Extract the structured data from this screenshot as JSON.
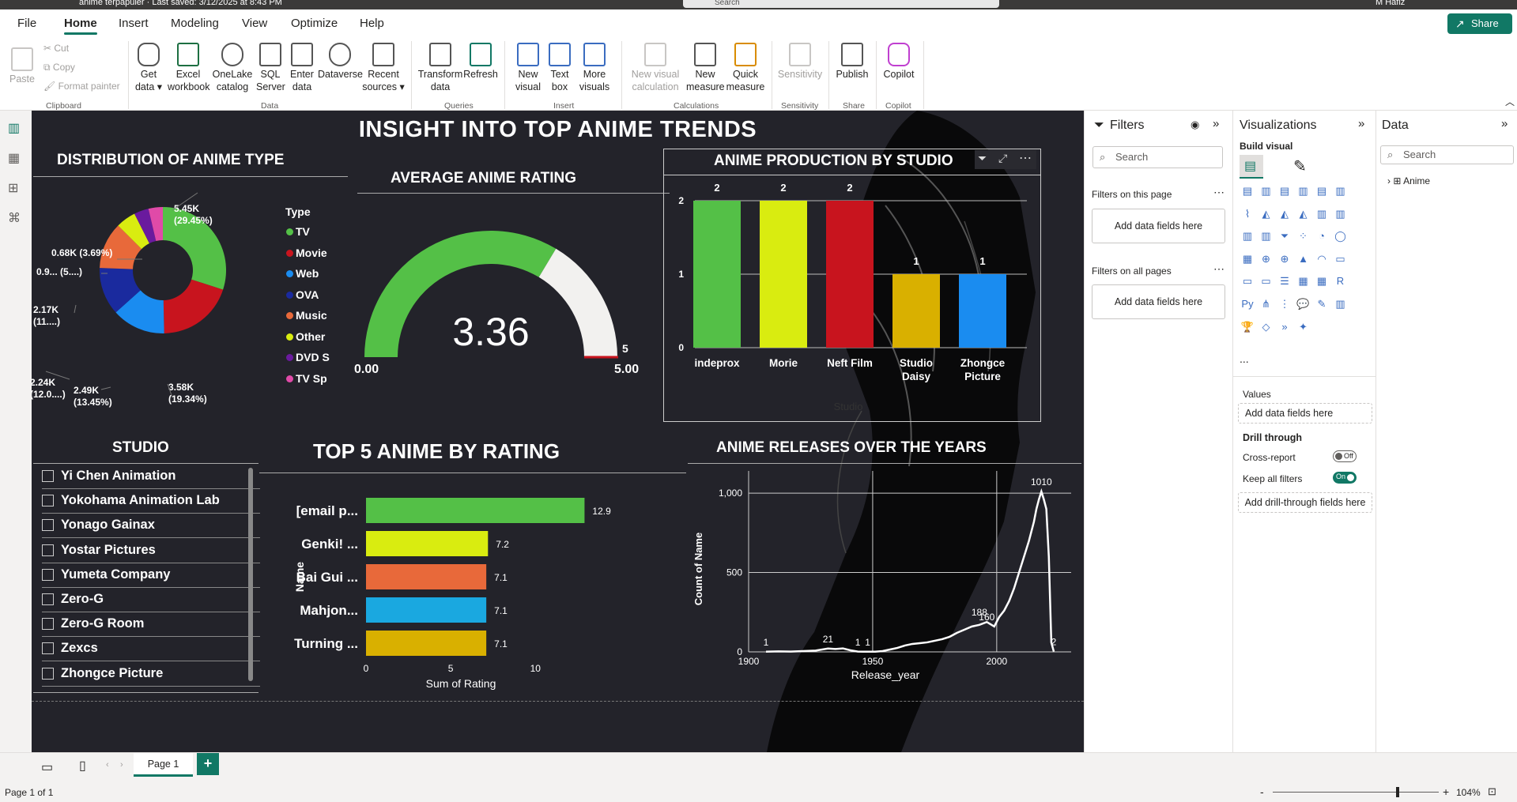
{
  "titlebar": {
    "text": "anime terpapuler  ·  Last saved: 3/12/2025 at 8:43 PM",
    "search_placeholder": "Search",
    "user": "M Hafiz"
  },
  "menu": {
    "items": [
      "File",
      "Home",
      "Insert",
      "Modeling",
      "View",
      "Optimize",
      "Help"
    ],
    "share": "Share"
  },
  "ribbon": {
    "clipboard": {
      "paste": "Paste",
      "cut": "Cut",
      "copy": "Copy",
      "format_painter": "Format painter",
      "group": "Clipboard"
    },
    "data": {
      "get_data": "Get data",
      "excel": "Excel workbook",
      "onelake": "OneLake catalog",
      "sql": "SQL Server",
      "enter": "Enter data",
      "dataverse": "Dataverse",
      "recent": "Recent sources",
      "group": "Data"
    },
    "queries": {
      "transform": "Transform data",
      "refresh": "Refresh",
      "group": "Queries"
    },
    "insert": {
      "new_visual": "New visual",
      "text_box": "Text box",
      "more": "More visuals",
      "group": "Insert"
    },
    "calculations": {
      "new_calc": "New visual calculation",
      "new_measure": "New measure",
      "quick_measure": "Quick measure",
      "group": "Calculations"
    },
    "sensitivity": {
      "label": "Sensitivity",
      "group": "Sensitivity"
    },
    "share": {
      "publish": "Publish",
      "group": "Share"
    },
    "copilot": {
      "label": "Copilot",
      "group": "Copilot"
    }
  },
  "dashboard": {
    "title": "INSIGHT INTO TOP ANIME TRENDS",
    "donut": {
      "title": "DISTRIBUTION OF ANIME TYPE",
      "legend_title": "Type",
      "legend": [
        {
          "name": "TV",
          "color": "#54c047"
        },
        {
          "name": "Movie",
          "color": "#c8141e"
        },
        {
          "name": "Web",
          "color": "#1a8cf0"
        },
        {
          "name": "OVA",
          "color": "#1a2a9e"
        },
        {
          "name": "Music",
          "color": "#e8693a"
        },
        {
          "name": "Other",
          "color": "#d9ec10"
        },
        {
          "name": "DVD S",
          "color": "#6a1a9e"
        },
        {
          "name": "TV Sp",
          "color": "#e04aa8"
        }
      ],
      "labels": {
        "tv": [
          "5.45K",
          "(29.45%)"
        ],
        "movie": [
          "3.58K",
          "(19.34%)"
        ],
        "web": [
          "2.49K",
          "(13.45%)"
        ],
        "ova": [
          "2.24K",
          "(12.0....)"
        ],
        "music": [
          "2.17K",
          "(11....)"
        ],
        "other": [
          "0.9... (5....)"
        ],
        "dvd": [
          "0.68K (3.69%)"
        ]
      }
    },
    "gauge": {
      "title": "AVERAGE ANIME RATING",
      "value": "3.36",
      "min": "0.00",
      "max": "5.00",
      "target": "5",
      "fraction": 0.672
    },
    "studio_bar": {
      "title": "ANIME PRODUCTION BY STUDIO",
      "axis_label": "Studio"
    },
    "slicer": {
      "title": "STUDIO",
      "items": [
        "Yi Chen Animation",
        "Yokohama Animation Lab",
        "Yonago Gainax",
        "Yostar Pictures",
        "Yumeta Company",
        "Zero-G",
        "Zero-G Room",
        "Zexcs",
        "Zhongce Picture"
      ]
    },
    "top5": {
      "title": "TOP 5 ANIME BY RATING",
      "ylabel": "Name",
      "xlabel": "Sum of Rating"
    },
    "releases": {
      "title": "ANIME RELEASES OVER THE YEARS",
      "ylabel": "Count of Name",
      "xlabel": "Release_year"
    }
  },
  "chart_data": [
    {
      "type": "pie",
      "title": "DISTRIBUTION OF ANIME TYPE",
      "categories": [
        "TV",
        "Movie",
        "Web",
        "OVA",
        "Music",
        "Other",
        "DVD S",
        "TV Sp"
      ],
      "values": [
        29.45,
        19.34,
        13.45,
        12.0,
        11.7,
        5.0,
        3.69,
        3.6
      ],
      "colors": [
        "#54c047",
        "#c8141e",
        "#1a8cf0",
        "#1a2a9e",
        "#e8693a",
        "#d9ec10",
        "#6a1a9e",
        "#e04aa8"
      ]
    },
    {
      "type": "bar",
      "title": "ANIME PRODUCTION BY STUDIO",
      "xlabel": "Studio",
      "categories": [
        "indeprox",
        "Morie",
        "Neft Film",
        "Studio Daisy",
        "Zhongce Picture"
      ],
      "values": [
        2,
        2,
        2,
        1,
        1
      ],
      "colors": [
        "#54c047",
        "#d9ec10",
        "#c8141e",
        "#d9b000",
        "#1a8cf0"
      ],
      "ylim": [
        0,
        2
      ],
      "yticks": [
        0,
        1,
        2
      ]
    },
    {
      "type": "bar",
      "title": "TOP 5 ANIME BY RATING",
      "orientation": "horizontal",
      "xlabel": "Sum of Rating",
      "ylabel": "Name",
      "categories": [
        "[email p...",
        "Genki! ...",
        "Bai Gui ...",
        "Mahjon...",
        "Turning ..."
      ],
      "values": [
        12.9,
        7.2,
        7.1,
        7.1,
        7.1
      ],
      "colors": [
        "#54c047",
        "#d9ec10",
        "#e8693a",
        "#1aa8e0",
        "#d9b000"
      ],
      "xlim": [
        0,
        14
      ],
      "xticks": [
        0,
        5,
        10
      ]
    },
    {
      "type": "line",
      "title": "ANIME RELEASES OVER THE YEARS",
      "xlabel": "Release_year",
      "ylabel": "Count of Name",
      "xlim": [
        1900,
        2030
      ],
      "ylim": [
        0,
        1100
      ],
      "xticks": [
        1900,
        1950,
        2000
      ],
      "yticks": [
        0,
        500,
        1000
      ],
      "ytick_labels": [
        "0",
        "500",
        "1,000"
      ],
      "x": [
        1907,
        1912,
        1917,
        1922,
        1927,
        1932,
        1935,
        1938,
        1941,
        1944,
        1946,
        1948,
        1951,
        1954,
        1957,
        1960,
        1963,
        1966,
        1969,
        1972,
        1975,
        1978,
        1981,
        1984,
        1987,
        1990,
        1993,
        1996,
        1999,
        2001,
        2003,
        2005,
        2007,
        2009,
        2011,
        2013,
        2015,
        2016,
        2017,
        2018,
        2019,
        2020,
        2021,
        2022,
        2023
      ],
      "y": [
        1,
        3,
        2,
        5,
        8,
        21,
        18,
        22,
        10,
        2,
        1,
        1,
        1,
        5,
        15,
        25,
        40,
        50,
        55,
        60,
        70,
        80,
        95,
        120,
        140,
        160,
        170,
        188,
        160,
        220,
        260,
        320,
        400,
        500,
        600,
        700,
        820,
        900,
        960,
        1010,
        960,
        900,
        600,
        60,
        2
      ],
      "point_labels": [
        {
          "x": 1907,
          "y": 1,
          "text": "1"
        },
        {
          "x": 1932,
          "y": 21,
          "text": "21"
        },
        {
          "x": 1944,
          "y": 1,
          "text": "1"
        },
        {
          "x": 1948,
          "y": 1,
          "text": "1"
        },
        {
          "x": 1993,
          "y": 188,
          "text": "188"
        },
        {
          "x": 1996,
          "y": 160,
          "text": "160"
        },
        {
          "x": 2018,
          "y": 1010,
          "text": "1010"
        },
        {
          "x": 2023,
          "y": 2,
          "text": "2"
        }
      ]
    }
  ],
  "filters": {
    "title": "Filters",
    "search": "Search",
    "this_page": "Filters on this page",
    "all_pages": "Filters on all pages",
    "add": "Add data fields here"
  },
  "viz": {
    "title": "Visualizations",
    "build": "Build visual",
    "values": "Values",
    "add": "Add data fields here",
    "drill": "Drill through",
    "cross": "Cross-report",
    "cross_state": "Off",
    "keep": "Keep all filters",
    "keep_state": "On",
    "add_drill": "Add drill-through fields here",
    "more": "..."
  },
  "data_pane": {
    "title": "Data",
    "search": "Search",
    "table": "Anime"
  },
  "pages": {
    "tab": "Page 1",
    "add": "+"
  },
  "status": {
    "page": "Page 1 of 1",
    "zoom": "104%",
    "minus": "-",
    "plus": "+"
  }
}
